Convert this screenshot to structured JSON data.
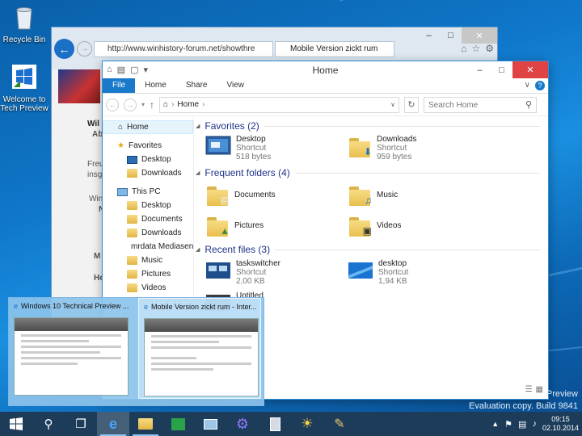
{
  "desktop": {
    "icons": [
      {
        "label": "Recycle Bin"
      },
      {
        "label": "Welcome to Tech Preview"
      }
    ],
    "watermark_preview": "Preview",
    "watermark_eval": "Evaluation copy. Build 9841"
  },
  "ie": {
    "address": "http://www.winhistory-forum.net/showthre",
    "tab_title": "Mobile Version zickt rum",
    "fragments": [
      "Wil",
      "Ab",
      "Freu",
      "insge",
      "Win",
      "N",
      "M",
      "Her"
    ]
  },
  "explorer": {
    "title": "Home",
    "ribbon_tabs": [
      "File",
      "Home",
      "Share",
      "View"
    ],
    "breadcrumb": "Home",
    "search_placeholder": "Search Home",
    "nav": {
      "home": "Home",
      "favorites": "Favorites",
      "fav_items": [
        "Desktop",
        "Downloads"
      ],
      "this_pc": "This PC",
      "pc_items": [
        "Desktop",
        "Documents",
        "Downloads",
        "mrdata Mediasen",
        "Music",
        "Pictures",
        "Videos"
      ]
    },
    "groups": {
      "favorites": "Favorites (2)",
      "frequent": "Frequent folders (4)",
      "recent": "Recent files (3)"
    },
    "favorites": [
      {
        "name": "Desktop",
        "type": "Shortcut",
        "size": "518 bytes"
      },
      {
        "name": "Downloads",
        "type": "Shortcut",
        "size": "959 bytes"
      }
    ],
    "frequent": [
      "Documents",
      "Music",
      "Pictures",
      "Videos"
    ],
    "recent": [
      {
        "name": "taskswitcher",
        "type": "Shortcut",
        "size": "2,00 KB"
      },
      {
        "name": "desktop",
        "type": "Shortcut",
        "size": "1,94 KB"
      },
      {
        "name": "Untitled"
      }
    ]
  },
  "peek": {
    "items": [
      {
        "title": "Windows 10 Technical Preview ..."
      },
      {
        "title": "Mobile Version zickt rum - Inter..."
      }
    ]
  },
  "taskbar": {
    "time": "09:15",
    "date": "02.10.2014"
  }
}
